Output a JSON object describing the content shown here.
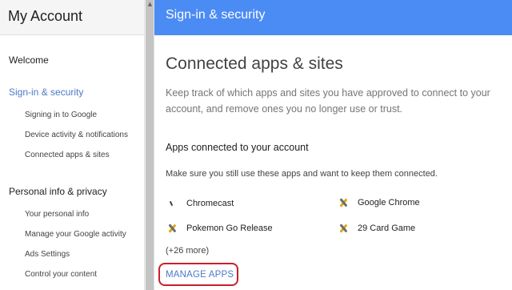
{
  "sidebar": {
    "title": "My Account",
    "sections": [
      {
        "label": "Welcome"
      },
      {
        "label": "Sign-in & security",
        "active": true,
        "items": [
          "Signing in to Google",
          "Device activity & notifications",
          "Connected apps & sites"
        ]
      },
      {
        "label": "Personal info & privacy",
        "items": [
          "Your personal info",
          "Manage your Google activity",
          "Ads Settings",
          "Control your content"
        ]
      }
    ]
  },
  "topbar": {
    "title": "Sign-in & security"
  },
  "main": {
    "heading": "Connected apps & sites",
    "description": "Keep track of which apps and sites you have approved to connect to your account, and remove ones you no longer use or trust.",
    "apps_section": {
      "heading": "Apps connected to your account",
      "description": "Make sure you still use these apps and want to keep them connected.",
      "apps": [
        {
          "name": "Chromecast",
          "icon": "chromecast-icon"
        },
        {
          "name": "Google Chrome",
          "icon": "app-x-icon"
        },
        {
          "name": "Pokemon Go Release",
          "icon": "app-x-icon"
        },
        {
          "name": "29 Card Game",
          "icon": "app-x-icon"
        }
      ],
      "more": "(+26 more)",
      "manage_label": "MANAGE APPS"
    }
  },
  "colors": {
    "accent": "#4b8bf4",
    "link": "#4a7ac6",
    "highlight_outline": "#c8202a"
  }
}
